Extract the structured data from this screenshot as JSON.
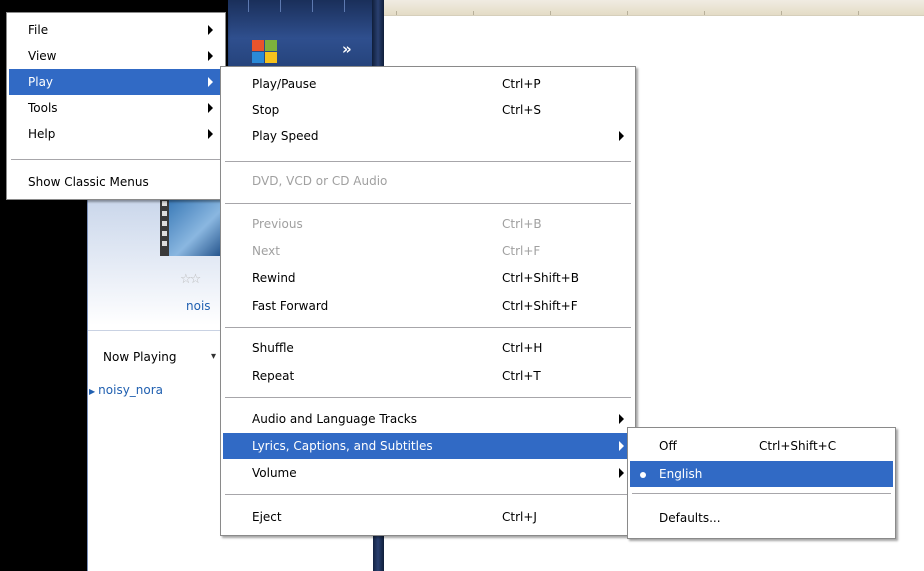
{
  "main_menu": {
    "items": [
      {
        "label": "File",
        "submenu": true
      },
      {
        "label": "View",
        "submenu": true
      },
      {
        "label": "Play",
        "submenu": true,
        "highlighted": true
      },
      {
        "label": "Tools",
        "submenu": true
      },
      {
        "label": "Help",
        "submenu": true
      }
    ],
    "show_classic_menus": "Show Classic Menus"
  },
  "play_menu": {
    "items": [
      {
        "label": "Play/Pause",
        "shortcut": "Ctrl+P"
      },
      {
        "label": "Stop",
        "shortcut": "Ctrl+S"
      },
      {
        "label": "Play Speed",
        "submenu": true
      },
      {
        "label": "DVD, VCD or CD Audio",
        "disabled": true
      },
      {
        "label": "Previous",
        "shortcut": "Ctrl+B",
        "disabled": true
      },
      {
        "label": "Next",
        "shortcut": "Ctrl+F",
        "disabled": true
      },
      {
        "label": "Rewind",
        "shortcut": "Ctrl+Shift+B"
      },
      {
        "label": "Fast Forward",
        "shortcut": "Ctrl+Shift+F"
      },
      {
        "label": "Shuffle",
        "shortcut": "Ctrl+H"
      },
      {
        "label": "Repeat",
        "shortcut": "Ctrl+T"
      },
      {
        "label": "Audio and Language Tracks",
        "submenu": true
      },
      {
        "label": "Lyrics, Captions, and Subtitles",
        "submenu": true,
        "highlighted": true
      },
      {
        "label": "Volume",
        "submenu": true
      },
      {
        "label": "Eject",
        "shortcut": "Ctrl+J"
      }
    ]
  },
  "lyrics_menu": {
    "items": [
      {
        "label": "Off",
        "shortcut": "Ctrl+Shift+C"
      },
      {
        "label": "English",
        "selected": true,
        "highlighted": true
      },
      {
        "label": "Defaults..."
      }
    ]
  },
  "library": {
    "album_label": "nois",
    "now_playing": "Now Playing",
    "playlist_item": "noisy_nora"
  },
  "colors": {
    "highlight": "#316ac5",
    "disabled_text": "#a0a0a0",
    "link_blue": "#1f5fb0"
  },
  "icons": [
    "windows-logo-icon",
    "chevron-right-icon",
    "star-rating-icon",
    "dropdown-arrow-icon",
    "submenu-arrow-icon",
    "radio-bullet-icon"
  ]
}
